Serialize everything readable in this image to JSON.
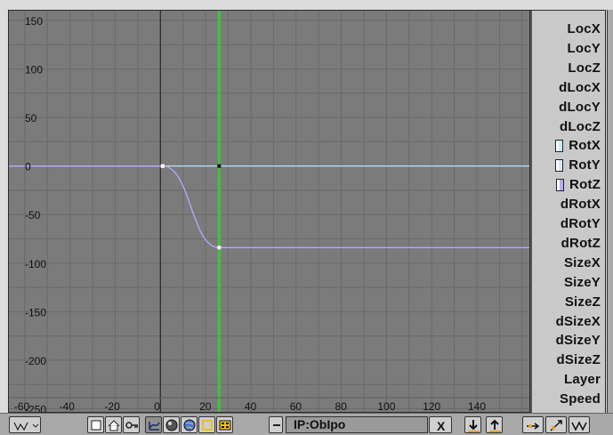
{
  "chart_data": {
    "type": "line",
    "xlim": [
      -67,
      164
    ],
    "ylim": [
      -255,
      160
    ],
    "x_ticks": [
      -60,
      -40,
      -20,
      0,
      20,
      40,
      60,
      80,
      100,
      120,
      140
    ],
    "y_ticks": [
      150,
      100,
      50,
      0,
      -50,
      -100,
      -150,
      -200,
      -250
    ],
    "x_tick_labels": [
      "-60",
      "-40",
      "-20",
      "0",
      "20",
      "40",
      "60",
      "80",
      "100",
      "120",
      "140"
    ],
    "y_tick_labels": [
      "150",
      "100",
      "50",
      "0",
      "-50",
      "-100",
      "-150",
      "-200",
      "-250"
    ],
    "grid": true,
    "current_frame": 26,
    "series": [
      {
        "name": "RotX",
        "color": "#b4e6ff",
        "points": [
          [
            -67,
            0
          ],
          [
            164,
            0
          ]
        ],
        "keys": [
          [
            1,
            0
          ],
          [
            26,
            0
          ]
        ]
      },
      {
        "name": "RotZ",
        "color": "#b8a8ff",
        "points": [
          [
            -67,
            -84
          ],
          [
            1,
            0
          ],
          [
            26,
            -84
          ],
          [
            164,
            -84
          ]
        ],
        "keys": [
          [
            1,
            0
          ],
          [
            26,
            -84
          ]
        ]
      }
    ]
  },
  "channels": [
    {
      "label": "LocX"
    },
    {
      "label": "LocY"
    },
    {
      "label": "LocZ"
    },
    {
      "label": "dLocX"
    },
    {
      "label": "dLocY"
    },
    {
      "label": "dLocZ"
    },
    {
      "label": "RotX",
      "swatch": "#bfefff"
    },
    {
      "label": "RotY",
      "swatch": "#d7e6ff"
    },
    {
      "label": "RotZ",
      "swatch": "#b9aaff"
    },
    {
      "label": "dRotX"
    },
    {
      "label": "dRotY"
    },
    {
      "label": "dRotZ"
    },
    {
      "label": "SizeX"
    },
    {
      "label": "SizeY"
    },
    {
      "label": "SizeZ"
    },
    {
      "label": "dSizeX"
    },
    {
      "label": "dSizeY"
    },
    {
      "label": "dSizeZ"
    },
    {
      "label": "Layer"
    },
    {
      "label": "Speed"
    }
  ],
  "header": {
    "ipo_name": "IP:ObIpo",
    "icons": [
      "window-type-icon",
      "object-icon",
      "world-icon",
      "key-icon",
      "curve-icon",
      "material-icon",
      "camera-icon",
      "lamp-icon",
      "sequence-icon"
    ],
    "delete_label": "X"
  },
  "colors": {
    "background": "#7b7b7b",
    "grid": "#6a6a6a",
    "frame_line": "#3ec53e",
    "zero_axis": "#1a1a1a"
  }
}
